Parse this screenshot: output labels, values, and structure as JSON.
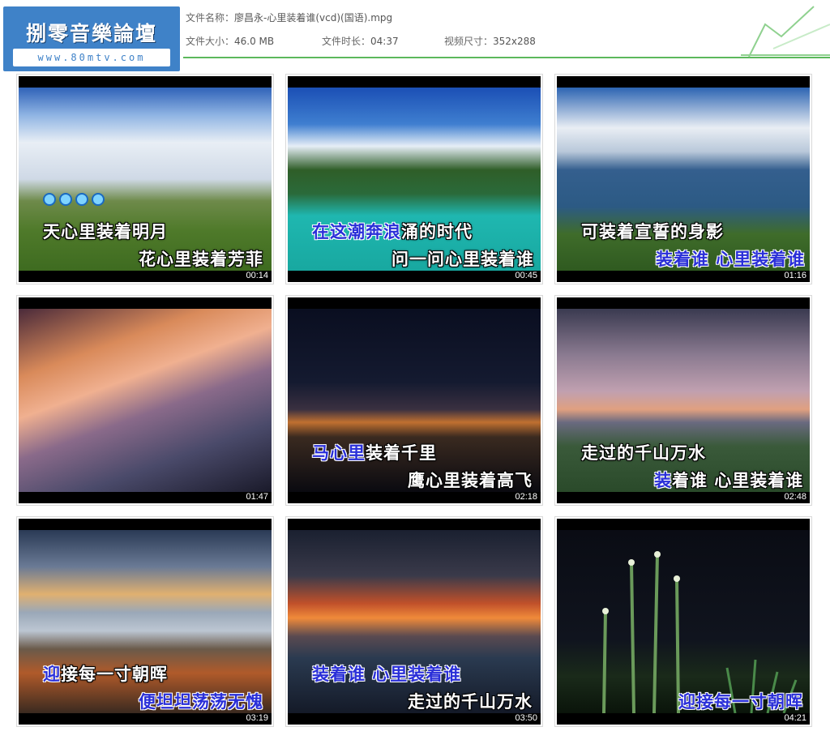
{
  "logo": {
    "title": "捌零音樂論壇",
    "url": "www.80mtv.com"
  },
  "file_info": {
    "name_label": "文件名称：",
    "name_value": "廖昌永-心里装着谁(vcd)(国语).mpg",
    "size_label": "文件大小：",
    "size_value": "46.0 MB",
    "duration_label": "文件时长：",
    "duration_value": "04:37",
    "resolution_label": "视频尺寸：",
    "resolution_value": "352x288"
  },
  "accent_color": "#5cb85c",
  "thumbnails": [
    {
      "time": "00:14",
      "line1": "天心里装着明月",
      "line2": "花心里装着芳菲",
      "highlight": "none"
    },
    {
      "time": "00:45",
      "line1": "在这潮奔浪涌的时代",
      "line2": "问一问心里装着谁",
      "highlight": "line1-partial"
    },
    {
      "time": "01:16",
      "line1": "可装着宣誓的身影",
      "line2": "装着谁 心里装着谁",
      "highlight": "line2"
    },
    {
      "time": "01:47",
      "line1": "",
      "line2": "",
      "highlight": "none"
    },
    {
      "time": "02:18",
      "line1": "马心里装着千里",
      "line2": "鹰心里装着高飞",
      "highlight": "line1-partial"
    },
    {
      "time": "02:48",
      "line1": "走过的千山万水",
      "line2": "装着谁 心里装着谁",
      "highlight": "line2-partial"
    },
    {
      "time": "03:19",
      "line1": "迎接每一寸朝晖",
      "line2": "便坦坦荡荡无愧",
      "highlight": "line2"
    },
    {
      "time": "03:50",
      "line1": "装着谁 心里装着谁",
      "line2": "走过的千山万水",
      "highlight": "line1"
    },
    {
      "time": "04:21",
      "line1": "",
      "line2": "迎接每一寸朝晖",
      "highlight": "line2"
    }
  ]
}
